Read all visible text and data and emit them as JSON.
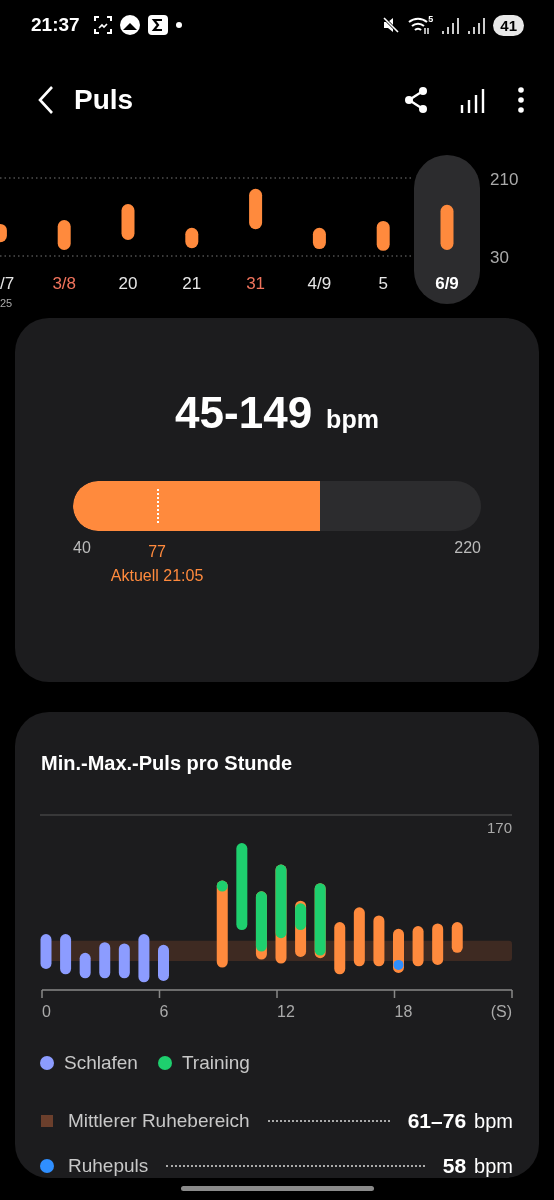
{
  "status_bar": {
    "time": "21:37",
    "network": "5",
    "battery": "41"
  },
  "header": {
    "title": "Puls"
  },
  "days": [
    {
      "sublabel": "25",
      "color": "#e6e6e6",
      "selected": false
    },
    {
      "color": "#f0735c",
      "selected": false
    },
    {
      "color": "#e6e6e6",
      "selected": false
    },
    {
      "color": "#e6e6e6",
      "selected": false
    },
    {
      "color": "#f0735c",
      "selected": false
    },
    {
      "color": "#e6e6e6",
      "selected": false
    },
    {
      "color": "#e6e6e6",
      "selected": false
    },
    {
      "color": "#ffffff",
      "selected": true
    }
  ],
  "day_chart": {
    "chart_data": {
      "type": "candlestick",
      "categories": [
        "/7",
        "3/8",
        "20",
        "21",
        "31",
        "4/9",
        "5",
        "6/9"
      ],
      "ylim": [
        30,
        210
      ],
      "yticks": [
        {
          "value": 30,
          "label": "30"
        },
        {
          "value": 210,
          "label": "210"
        }
      ],
      "series": [
        {
          "color": "#ff8a3d",
          "ohlc": [
            [
              62,
              104,
              62,
              104
            ],
            [
              44,
              113,
              44,
              113
            ],
            [
              67,
              150,
              67,
              150
            ],
            [
              48,
              95,
              48,
              95
            ],
            [
              92,
              185,
              92,
              185
            ],
            [
              46,
              95,
              46,
              95
            ],
            [
              42,
              111,
              42,
              111
            ],
            [
              44,
              148,
              44,
              148
            ]
          ]
        }
      ]
    }
  },
  "summary": {
    "range": "45-149",
    "unit": "bpm",
    "level": 0.606,
    "scale_min": "40",
    "scale_max": "220",
    "marker": {
      "value": "77",
      "caption": "Aktuell 21:05",
      "level": 0.206
    }
  },
  "hourly": {
    "title": "Min.-Max.-Puls pro Stunde",
    "top_label": "170",
    "hour_labels": [
      "0",
      "6",
      "12",
      "18",
      "(S)"
    ],
    "legend": [
      {
        "label": "Schlafen",
        "color": "#8c9cff"
      },
      {
        "label": "Training",
        "color": "#1ecf6e"
      }
    ],
    "stats": [
      {
        "kind": "square",
        "label": "Mittlerer Ruhebereich",
        "value": "61–76",
        "unit": "bpm",
        "color": "#6b3f2c"
      },
      {
        "kind": "dot",
        "label": "Ruhepuls",
        "value": "58",
        "unit": "bpm",
        "color": "#2f8fff"
      }
    ]
  }
}
